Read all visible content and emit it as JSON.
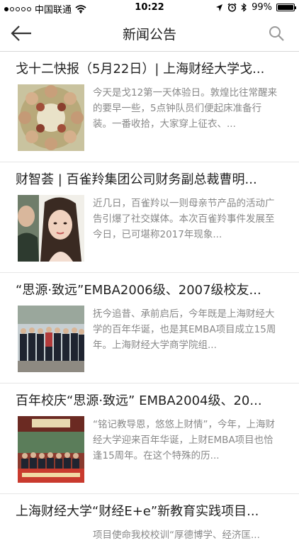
{
  "status_bar": {
    "carrier": "中国联通",
    "time": "10:22",
    "battery": "99%",
    "battery_level": 0.99
  },
  "nav": {
    "title": "新闻公告",
    "icons": {
      "back": "back-arrow-icon",
      "search": "search-icon"
    }
  },
  "news": [
    {
      "title": "戈十二快报（5月22日）| 上海财经大学戈...",
      "summary": "今天是戈12第一天体验日。敦煌比往常醒来的要早一些，5点钟队员们便起床准备行装。一番收拾，大家穿上征衣、..."
    },
    {
      "title": "财智荟 | 百雀羚集团公司财务副总裁曹明...",
      "summary": "近几日，百雀羚以一则母亲节产品的活动广告引爆了社交媒体。本次百雀羚事件发展至今日，已可堪称2017年现象..."
    },
    {
      "title": "“思源·致远”EMBA2006级、2007级校友...",
      "summary": "抚今追昔、承前启后，今年既是上海财经大学的百年华诞，也是其EMBA项目成立15周年。上海财经大学商学院组..."
    },
    {
      "title": "百年校庆“思源·致远” EMBA2004级、20...",
      "summary": "“铭记教导恩，悠悠上财情”，今年，上海财经大学迎来百年华诞，上财EMBA项目也恰逢15周年。在这个特殊的历..."
    },
    {
      "title": "上海财经大学“财经E+e”新教育实践项目...",
      "summary": "项目使命我校校训“厚德博学、经济匡..."
    }
  ]
}
